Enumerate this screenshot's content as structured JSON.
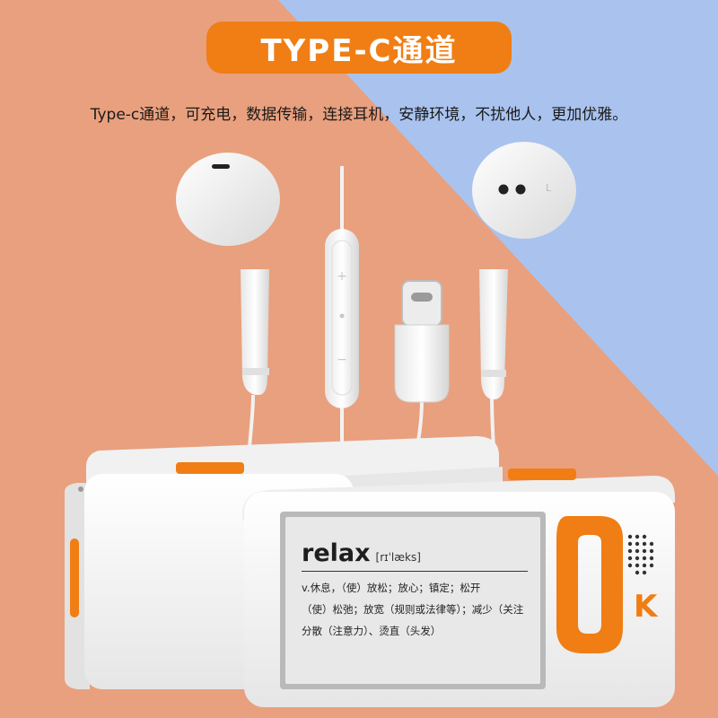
{
  "header": {
    "title": "TYPE-C通道",
    "subtitle": "Type-c通道，可充电，数据传输，连接耳机，安静环境，不扰他人，更加优雅。"
  },
  "colors": {
    "left_background": "#e9a07e",
    "right_background": "#a9c3ee",
    "accent_orange": "#f07e14",
    "device_white": "#f7f7f7",
    "screen_gray": "#e8e8e8"
  },
  "earphone": {
    "right_bud_mark": "L"
  },
  "device": {
    "screen": {
      "word": "relax",
      "phonetic": "[rɪˈlæks]",
      "definitions": [
        "v.休息，（使）放松；放心；镇定；松开",
        "（使）松弛；放宽（规则或法律等）；减少（关注",
        "分散（注意力）、烫直（头发）"
      ]
    },
    "logo_letter": "K"
  }
}
